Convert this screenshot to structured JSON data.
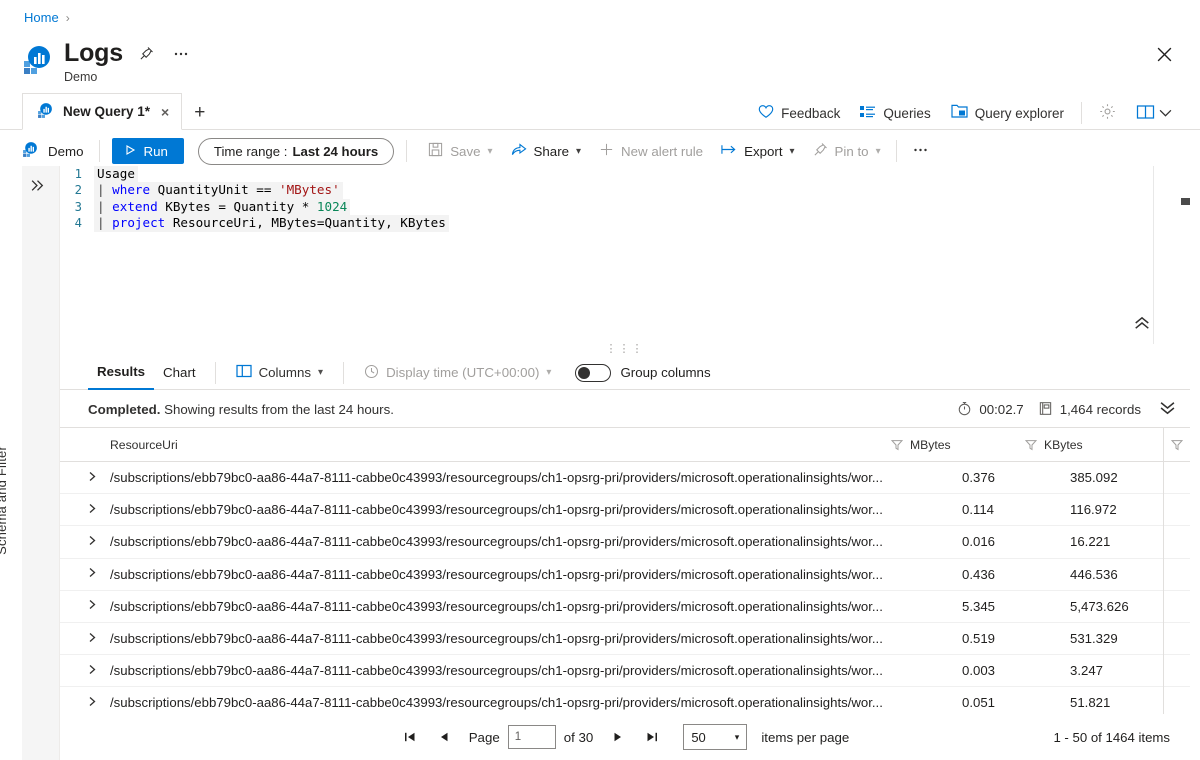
{
  "breadcrumb": {
    "home": "Home",
    "separator": "›"
  },
  "header": {
    "title": "Logs",
    "subtitle": "Demo",
    "pin_icon": "pin-icon",
    "more_icon": "ellipsis-icon",
    "close_icon": "close-icon"
  },
  "tabs": {
    "items": [
      {
        "label": "New Query 1*",
        "close": "×"
      }
    ],
    "add_label": "+"
  },
  "top_tools": [
    {
      "name": "feedback",
      "label": "Feedback",
      "icon": "heart-icon"
    },
    {
      "name": "queries",
      "label": "Queries",
      "icon": "list-icon"
    },
    {
      "name": "query-explorer",
      "label": "Query explorer",
      "icon": "folder-window-icon"
    }
  ],
  "top_tools_icons": [
    {
      "name": "settings",
      "icon": "gear-icon"
    },
    {
      "name": "help-book",
      "icon": "book-icon"
    },
    {
      "name": "chevron",
      "icon": "chevron-down-icon"
    }
  ],
  "commandbar": {
    "scope": "Demo",
    "run": "Run",
    "run_icon": "play-icon",
    "time_range_label": "Time range :",
    "time_range_value": "Last 24 hours",
    "save": "Save",
    "share": "Share",
    "new_alert_rule": "New alert rule",
    "export": "Export",
    "pin_to": "Pin to",
    "more": "···"
  },
  "rail": {
    "expand_icon": "double-chevron-right-icon",
    "label": "Schema and Filter"
  },
  "editor": {
    "collapse_icon": "double-chevron-up-icon",
    "lines": [
      {
        "n": "1",
        "tokens": [
          {
            "t": "plain",
            "v": "Usage"
          }
        ]
      },
      {
        "n": "2",
        "tokens": [
          {
            "t": "pipe",
            "v": "| "
          },
          {
            "t": "cmd",
            "v": "where"
          },
          {
            "t": "plain",
            "v": " QuantityUnit == "
          },
          {
            "t": "str",
            "v": "'MBytes'"
          }
        ]
      },
      {
        "n": "3",
        "tokens": [
          {
            "t": "pipe",
            "v": "| "
          },
          {
            "t": "cmd",
            "v": "extend"
          },
          {
            "t": "plain",
            "v": " KBytes = Quantity * "
          },
          {
            "t": "num",
            "v": "1024"
          }
        ]
      },
      {
        "n": "4",
        "tokens": [
          {
            "t": "pipe",
            "v": "| "
          },
          {
            "t": "cmd",
            "v": "project"
          },
          {
            "t": "plain",
            "v": " ResourceUri, MBytes=Quantity, KBytes"
          }
        ]
      }
    ]
  },
  "results": {
    "tab_results": "Results",
    "tab_chart": "Chart",
    "columns_label": "Columns",
    "display_time_label": "Display time (UTC+00:00)",
    "group_columns_label": "Group columns",
    "group_columns_on": false,
    "status_bold": "Completed.",
    "status_rest": " Showing results from the last 24 hours.",
    "duration": "00:02.7",
    "records": "1,464 records",
    "expand_icon": "double-chevron-down-icon"
  },
  "table": {
    "columns": [
      "ResourceUri",
      "MBytes",
      "KBytes"
    ],
    "filter_icon": "filter-icon",
    "expand_icon": "chevron-right-icon",
    "rows": [
      {
        "uri": "/subscriptions/ebb79bc0-aa86-44a7-8111-cabbe0c43993/resourcegroups/ch1-opsrg-pri/providers/microsoft.operationalinsights/wor...",
        "mbytes": "0.376",
        "kbytes": "385.092"
      },
      {
        "uri": "/subscriptions/ebb79bc0-aa86-44a7-8111-cabbe0c43993/resourcegroups/ch1-opsrg-pri/providers/microsoft.operationalinsights/wor...",
        "mbytes": "0.114",
        "kbytes": "116.972"
      },
      {
        "uri": "/subscriptions/ebb79bc0-aa86-44a7-8111-cabbe0c43993/resourcegroups/ch1-opsrg-pri/providers/microsoft.operationalinsights/wor...",
        "mbytes": "0.016",
        "kbytes": "16.221"
      },
      {
        "uri": "/subscriptions/ebb79bc0-aa86-44a7-8111-cabbe0c43993/resourcegroups/ch1-opsrg-pri/providers/microsoft.operationalinsights/wor...",
        "mbytes": "0.436",
        "kbytes": "446.536"
      },
      {
        "uri": "/subscriptions/ebb79bc0-aa86-44a7-8111-cabbe0c43993/resourcegroups/ch1-opsrg-pri/providers/microsoft.operationalinsights/wor...",
        "mbytes": "5.345",
        "kbytes": "5,473.626"
      },
      {
        "uri": "/subscriptions/ebb79bc0-aa86-44a7-8111-cabbe0c43993/resourcegroups/ch1-opsrg-pri/providers/microsoft.operationalinsights/wor...",
        "mbytes": "0.519",
        "kbytes": "531.329"
      },
      {
        "uri": "/subscriptions/ebb79bc0-aa86-44a7-8111-cabbe0c43993/resourcegroups/ch1-opsrg-pri/providers/microsoft.operationalinsights/wor...",
        "mbytes": "0.003",
        "kbytes": "3.247"
      },
      {
        "uri": "/subscriptions/ebb79bc0-aa86-44a7-8111-cabbe0c43993/resourcegroups/ch1-opsrg-pri/providers/microsoft.operationalinsights/wor...",
        "mbytes": "0.051",
        "kbytes": "51.821"
      }
    ]
  },
  "pager": {
    "first_icon": "first-page-icon",
    "prev_icon": "previous-page-icon",
    "next_icon": "next-page-icon",
    "last_icon": "last-page-icon",
    "page_label": "Page",
    "page_value": "1",
    "of_label": "of 30",
    "page_size": "50",
    "items_per_page_label": "items per page",
    "range_label": "1 - 50 of 1464 items"
  },
  "colors": {
    "accent": "#0078d4",
    "text": "#201f1e",
    "muted": "#a19f9d",
    "border": "#e1dfdd"
  }
}
